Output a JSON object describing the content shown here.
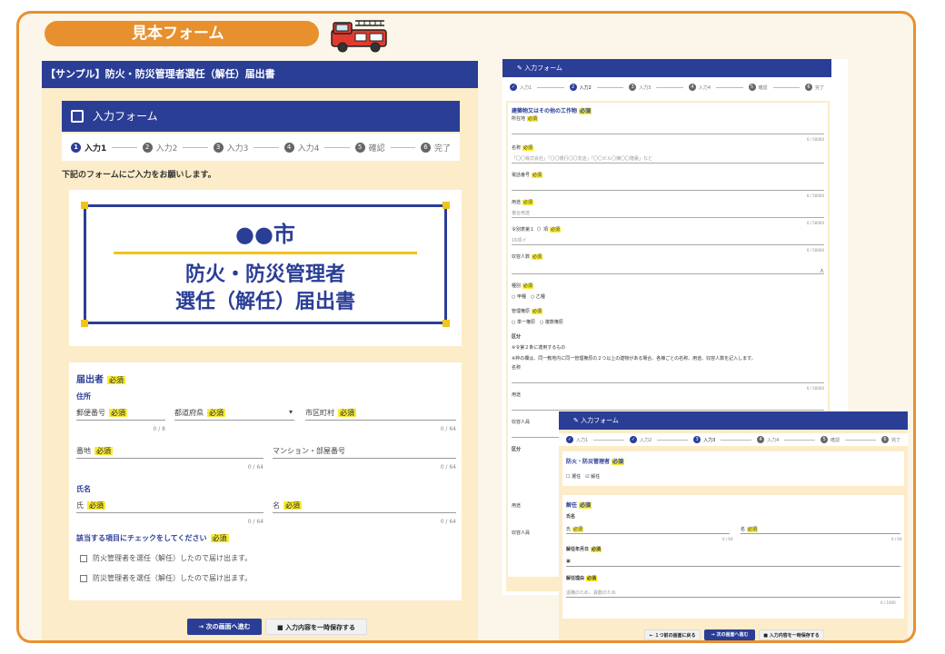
{
  "banner": {
    "label": "見本フォーム"
  },
  "left": {
    "window_title": "【サンプル】防火・防災管理者選任（解任）届出書",
    "card_title": "入力フォーム",
    "steps": [
      {
        "num": "1",
        "label": "入力1"
      },
      {
        "num": "2",
        "label": "入力2"
      },
      {
        "num": "3",
        "label": "入力3"
      },
      {
        "num": "4",
        "label": "入力4"
      },
      {
        "num": "5",
        "label": "確認"
      },
      {
        "num": "6",
        "label": "完了"
      }
    ],
    "intro": "下記のフォームにご入力をお願いします。",
    "title_card": {
      "city": "●●市",
      "line1": "防火・防災管理者",
      "line2": "選任（解任）届出書"
    },
    "required": "必須",
    "section": "届出者",
    "address": "住所",
    "postal": "郵便番号",
    "postal_count": "0 / 8",
    "prefecture": "都道府県",
    "city_field": "市区町村",
    "city_count": "0 / 64",
    "street": "番地",
    "street_count": "0 / 64",
    "building": "マンション・部屋番号",
    "building_count": "0 / 64",
    "name_title": "氏名",
    "last_name": "氏",
    "last_count": "0 / 64",
    "first_name": "名",
    "first_count": "0 / 64",
    "check_title": "該当する項目にチェックをしてください",
    "check1": "防火管理者を選任（解任）したので届け出ます。",
    "check2": "防災管理者を選任（解任）したので届け出ます。",
    "next": "次の画面へ進む",
    "save": "入力内容を一時保存する"
  },
  "middle": {
    "card_title": "入力フォーム",
    "steps": [
      "入力1",
      "入力2",
      "入力3",
      "入力4",
      "確認",
      "完了"
    ],
    "required": "必須",
    "building_title": "建築物又はその他の工作物",
    "location": "所在地",
    "name": "名称",
    "name_placeholder": "「〇〇株式会社」「〇〇银行〇〇支店」「〇〇ビル〇棟〇〇階裏」など",
    "phone": "電話番号",
    "use": "用途",
    "use_placeholder": "複合用途",
    "order": "令別表第１（）項",
    "order_placeholder": "16項イ",
    "capacity": "収容人数",
    "capacity_unit": "人",
    "type": "種別",
    "type_a": "甲種",
    "type_b": "乙種",
    "mgmt": "管理権原",
    "mgmt_a": "単一権原",
    "mgmt_b": "複数権原",
    "division": "区分",
    "division_note": "※令第２条に適用するもの",
    "division_desc": "※枠の欄は、同一敷地内に同一管理権原の２つ以上の建物がある場合、各棟ごとの名称、用途、収容人数を記入します。",
    "count": "0 / 50000",
    "capacity_short": "収容人員"
  },
  "right": {
    "card_title": "入力フォーム",
    "steps": [
      "入力1",
      "入力2",
      "入力3",
      "入力4",
      "確認",
      "完了"
    ],
    "section": "防火・防災管理者",
    "required": "必須",
    "select_label": "選任",
    "dismiss_label": "解任",
    "dismissal": "解任",
    "name": "氏名",
    "last": "氏",
    "first": "名",
    "count_small": "0 / 64",
    "date": "解任年月日",
    "reason": "解任理由",
    "reason_placeholder": "退職のため、異動のため",
    "reason_count": "0 / 1000",
    "back": "１つ前の画面に戻る",
    "next": "次の画面へ進む",
    "save": "入力内容を一時保存する"
  },
  "colors": {
    "accent": "#e8902e",
    "navy": "#2b3e96",
    "required_bg": "#f8eb32",
    "panel_bg": "#fcecc9"
  }
}
